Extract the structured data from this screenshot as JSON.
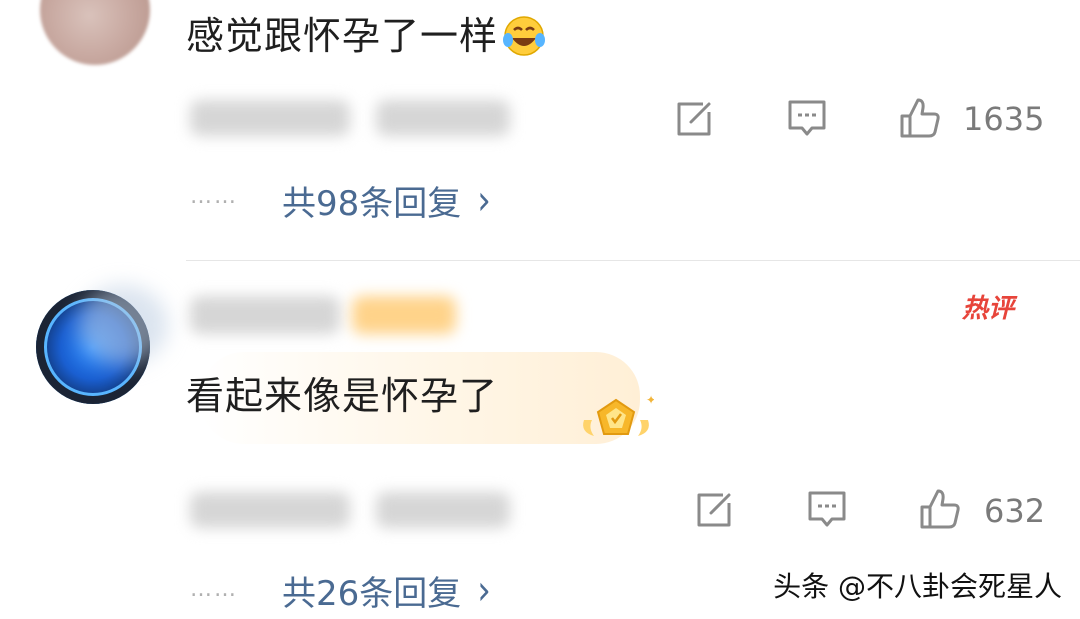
{
  "comments": [
    {
      "text": "感觉跟怀孕了一样",
      "emoji": "laugh-cry-emoji",
      "likes": "1635",
      "replies_label": "共98条回复",
      "dots": "……"
    },
    {
      "text": "看起来像是怀孕了",
      "badge": "热评",
      "likes": "632",
      "replies_label": "共26条回复",
      "dots": "……"
    }
  ],
  "watermark": "头条 @不八卦会死星人",
  "colors": {
    "link": "#4a6a92",
    "hot": "#e7443a",
    "meta": "#7a7a7a"
  }
}
